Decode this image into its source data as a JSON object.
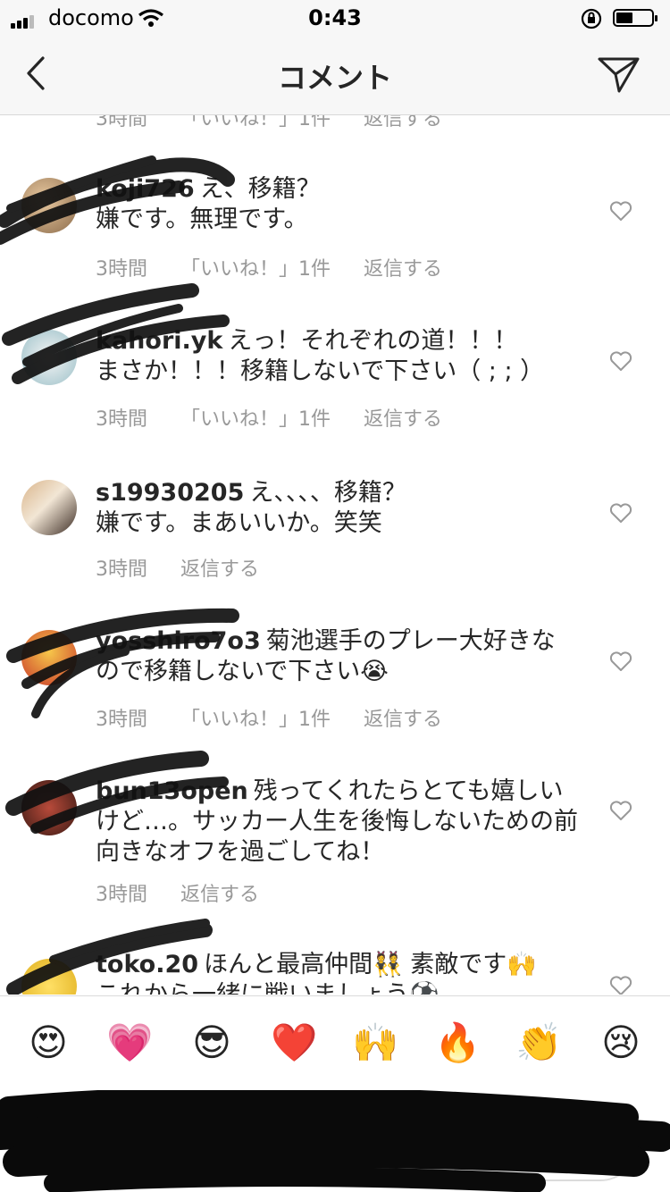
{
  "status_bar": {
    "carrier": "docomo",
    "time": "0:43"
  },
  "nav": {
    "title": "コメント"
  },
  "partial_meta": {
    "time": "3時間",
    "likes": "「いいね！」1件",
    "reply": "返信する"
  },
  "comments": [
    {
      "username": "koji726",
      "text": "え、移籍？\n嫌です。無理です。",
      "time": "3時間",
      "likes": "「いいね！」1件",
      "reply": "返信する"
    },
    {
      "username": "kahori.yk",
      "text": "えっ！それぞれの道！！！\nまさか！！！移籍しないで下さい（ ; ; ）",
      "time": "3時間",
      "likes": "「いいね！」1件",
      "reply": "返信する"
    },
    {
      "username": "s19930205",
      "text": "え、、、、移籍？\n嫌です。まあいいか。笑笑",
      "time": "3時間",
      "likes": "",
      "reply": "返信する"
    },
    {
      "username": "yosshiro7o3",
      "text": "菊池選手のプレー大好きなので移籍しないで下さい😭",
      "time": "3時間",
      "likes": "「いいね！」1件",
      "reply": "返信する"
    },
    {
      "username": "bun13open",
      "text": "残ってくれたらとても嬉しいけど…。サッカー人生を後悔しないための前向きなオフを過ごしてね！",
      "time": "3時間",
      "likes": "",
      "reply": "返信する"
    },
    {
      "username": "toko.20",
      "text": "ほんと最高仲間👯 素敵です🙌\nこれから一緒に戦いましょう⚽",
      "time": "",
      "likes": "",
      "reply": ""
    }
  ],
  "emoji_bar": [
    "😍",
    "💗",
    "😎",
    "❤️",
    "🙌",
    "🔥",
    "👏",
    "😢"
  ]
}
